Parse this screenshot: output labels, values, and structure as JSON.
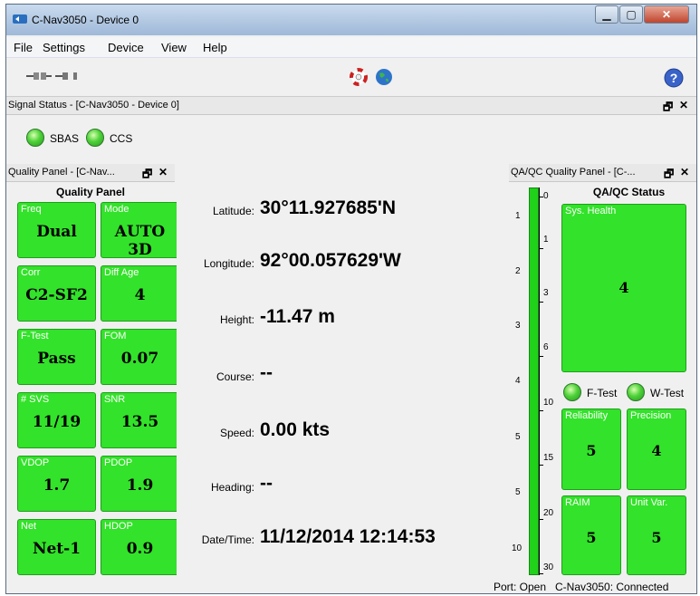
{
  "window": {
    "title": "C-Nav3050 - Device 0"
  },
  "menu": [
    "File",
    "Settings",
    "Device",
    "View",
    "Help"
  ],
  "signal_panel": {
    "title": "Signal Status - [C-Nav3050 - Device 0]",
    "leds": [
      {
        "label": "SBAS"
      },
      {
        "label": "CCS"
      }
    ]
  },
  "quality_panel": {
    "dock_title": "Quality Panel - [C-Nav...",
    "heading": "Quality Panel",
    "tiles": [
      {
        "label": "Freq",
        "value": "Dual"
      },
      {
        "label": "Mode",
        "value": "AUTO 3D"
      },
      {
        "label": "Corr",
        "value": "C2-SF2"
      },
      {
        "label": "Diff Age",
        "value": "4"
      },
      {
        "label": "F-Test",
        "value": "Pass"
      },
      {
        "label": "FOM",
        "value": "0.07"
      },
      {
        "label": "# SVS",
        "value": "11/19"
      },
      {
        "label": "SNR",
        "value": "13.5"
      },
      {
        "label": "VDOP",
        "value": "1.7"
      },
      {
        "label": "PDOP",
        "value": "1.9"
      },
      {
        "label": "Net",
        "value": "Net-1"
      },
      {
        "label": "HDOP",
        "value": "0.9"
      }
    ]
  },
  "nav": {
    "rows": [
      {
        "label": "Latitude:",
        "value": "30°11.927685'N"
      },
      {
        "label": "Longitude:",
        "value": "92°00.057629'W"
      },
      {
        "label": "Height:",
        "value": "-11.47 m"
      },
      {
        "label": "Course:",
        "value": "--"
      },
      {
        "label": "Speed:",
        "value": "0.00 kts"
      },
      {
        "label": "Heading:",
        "value": "--"
      },
      {
        "label": "Date/Time:",
        "value": "11/12/2014 12:14:53"
      }
    ]
  },
  "qa_panel": {
    "dock_title": "QA/QC Quality Panel - [C-...",
    "heading": "QA/QC Status",
    "left_scale": [
      "1",
      "2",
      "3",
      "4",
      "5",
      "5",
      "10"
    ],
    "right_scale": [
      "0",
      "1",
      "3",
      "6",
      "10",
      "15",
      "20",
      "30"
    ],
    "sys_health": {
      "label": "Sys. Health",
      "value": "4"
    },
    "leds": [
      {
        "label": "F-Test"
      },
      {
        "label": "W-Test"
      }
    ],
    "tiles": [
      {
        "label": "Reliability",
        "value": "5"
      },
      {
        "label": "Precision",
        "value": "4"
      },
      {
        "label": "RAIM",
        "value": "5"
      },
      {
        "label": "Unit Var.",
        "value": "5"
      }
    ]
  },
  "status_bar": {
    "port": "Port: Open",
    "connection": "C-Nav3050: Connected"
  },
  "colors": {
    "tile_green": "#33e22a",
    "label_white": "#ffffff",
    "titlebar": "#b7cde6",
    "close_red": "#c0452e"
  }
}
